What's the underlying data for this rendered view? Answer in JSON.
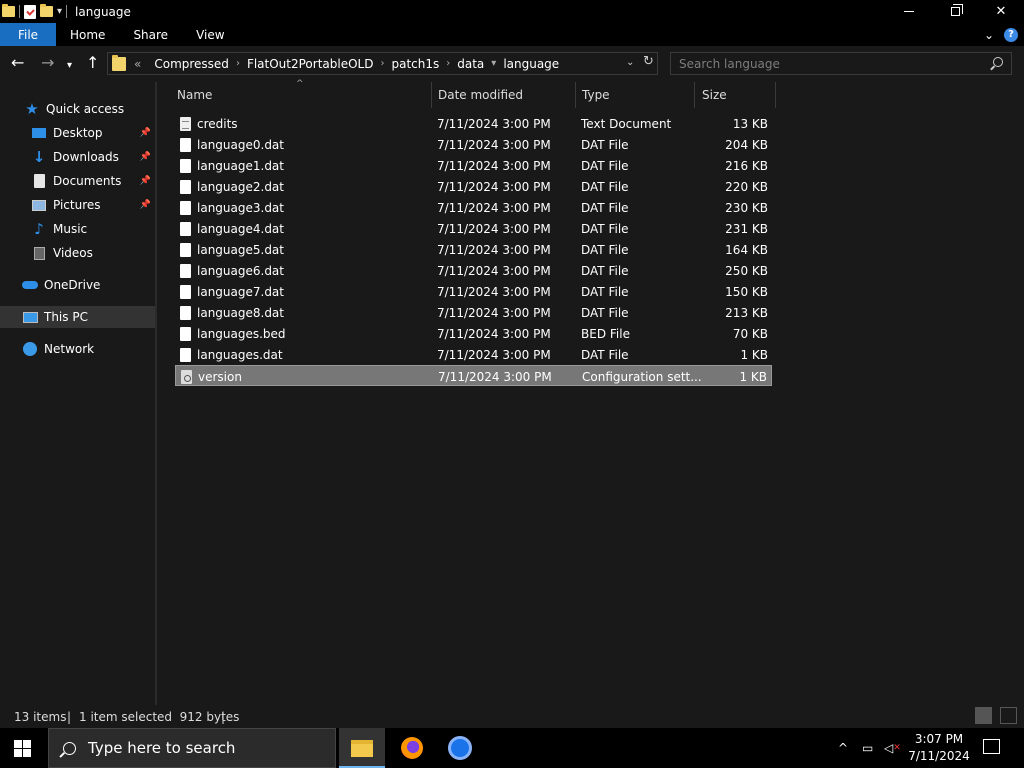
{
  "window": {
    "title": "language",
    "minimize": "—",
    "close": "✕"
  },
  "ribbon": {
    "tabs": [
      "File",
      "Home",
      "Share",
      "View"
    ],
    "help": "?"
  },
  "address": {
    "overflow": "«",
    "crumbs": [
      "Compressed",
      "FlatOut2PortableOLD",
      "patch1s",
      "data",
      "language"
    ]
  },
  "search": {
    "placeholder": "Search language"
  },
  "sidebar": {
    "items": [
      {
        "label": "Quick access",
        "icon": "star-icon",
        "pinned": false
      },
      {
        "label": "Desktop",
        "icon": "desktop-icon",
        "pinned": true
      },
      {
        "label": "Downloads",
        "icon": "download-icon",
        "pinned": true
      },
      {
        "label": "Documents",
        "icon": "documents-icon",
        "pinned": true
      },
      {
        "label": "Pictures",
        "icon": "pictures-icon",
        "pinned": true
      },
      {
        "label": "Music",
        "icon": "music-icon",
        "pinned": false
      },
      {
        "label": "Videos",
        "icon": "videos-icon",
        "pinned": false
      },
      {
        "label": "OneDrive",
        "icon": "onedrive-icon",
        "pinned": false
      },
      {
        "label": "This PC",
        "icon": "this-pc-icon",
        "pinned": false,
        "selected": true
      },
      {
        "label": "Network",
        "icon": "network-icon",
        "pinned": false
      }
    ]
  },
  "columns": {
    "name": "Name",
    "date": "Date modified",
    "type": "Type",
    "size": "Size"
  },
  "files": [
    {
      "name": "credits",
      "date": "7/11/2024 3:00 PM",
      "type": "Text Document",
      "size": "13 KB"
    },
    {
      "name": "language0.dat",
      "date": "7/11/2024 3:00 PM",
      "type": "DAT File",
      "size": "204 KB"
    },
    {
      "name": "language1.dat",
      "date": "7/11/2024 3:00 PM",
      "type": "DAT File",
      "size": "216 KB"
    },
    {
      "name": "language2.dat",
      "date": "7/11/2024 3:00 PM",
      "type": "DAT File",
      "size": "220 KB"
    },
    {
      "name": "language3.dat",
      "date": "7/11/2024 3:00 PM",
      "type": "DAT File",
      "size": "230 KB"
    },
    {
      "name": "language4.dat",
      "date": "7/11/2024 3:00 PM",
      "type": "DAT File",
      "size": "231 KB"
    },
    {
      "name": "language5.dat",
      "date": "7/11/2024 3:00 PM",
      "type": "DAT File",
      "size": "164 KB"
    },
    {
      "name": "language6.dat",
      "date": "7/11/2024 3:00 PM",
      "type": "DAT File",
      "size": "250 KB"
    },
    {
      "name": "language7.dat",
      "date": "7/11/2024 3:00 PM",
      "type": "DAT File",
      "size": "150 KB"
    },
    {
      "name": "language8.dat",
      "date": "7/11/2024 3:00 PM",
      "type": "DAT File",
      "size": "213 KB"
    },
    {
      "name": "languages.bed",
      "date": "7/11/2024 3:00 PM",
      "type": "BED File",
      "size": "70 KB"
    },
    {
      "name": "languages.dat",
      "date": "7/11/2024 3:00 PM",
      "type": "DAT File",
      "size": "1 KB"
    },
    {
      "name": "version",
      "date": "7/11/2024 3:00 PM",
      "type": "Configuration sett...",
      "size": "1 KB",
      "selected": true
    }
  ],
  "status": {
    "count": "13 items",
    "selection": "1 item selected  912 bytes"
  },
  "taskbar": {
    "search_placeholder": "Type here to search",
    "time": "3:07 PM",
    "date": "7/11/2024"
  },
  "colors": {
    "accent": "#1a6ec2",
    "background": "#191919",
    "selection": "#777777"
  }
}
